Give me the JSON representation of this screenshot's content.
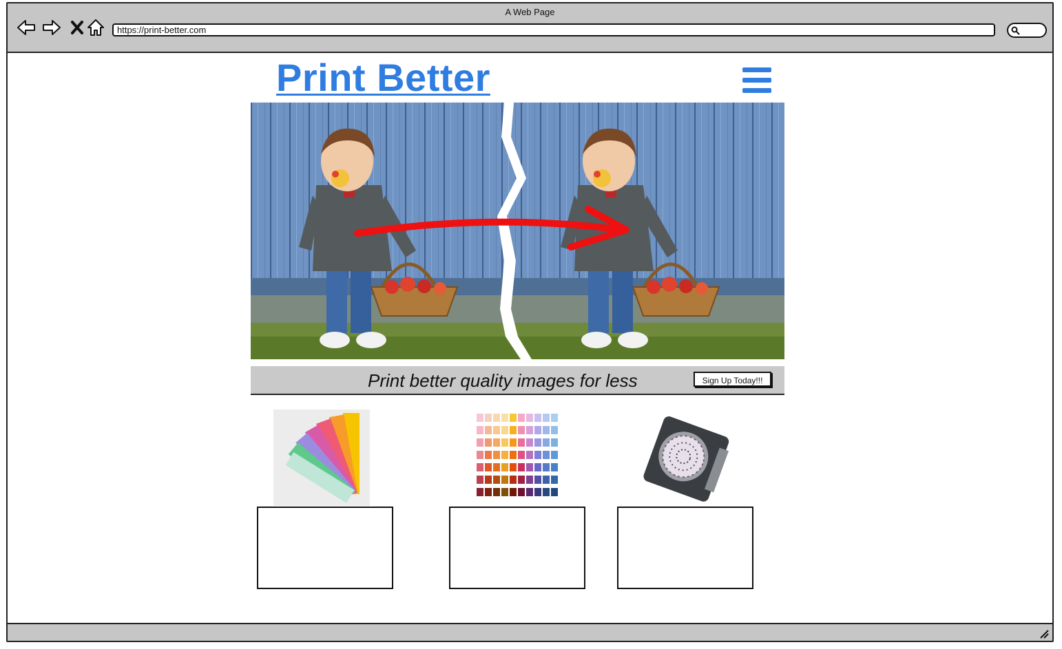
{
  "browser": {
    "window_title": "A Web Page",
    "url": "https://print-better.com",
    "nav_icons": [
      "back-icon",
      "forward-icon",
      "close-icon",
      "home-icon"
    ],
    "search_icon": "search-icon"
  },
  "header": {
    "logo_text": "Print Better",
    "menu_icon": "hamburger-menu-icon"
  },
  "hero": {
    "image_description": "before-and-after-photo-comparison"
  },
  "banner": {
    "tagline": "Print better quality images for less",
    "cta_label": "Sign Up Today!!!"
  },
  "features": [
    {
      "image": "color-fan-swatch"
    },
    {
      "image": "color-chart-grid"
    },
    {
      "image": "calibration-disc"
    }
  ],
  "colors": {
    "brand_blue": "#2f7de1",
    "chrome_gray": "#c6c6c6",
    "arrow_red": "#ee1111"
  }
}
